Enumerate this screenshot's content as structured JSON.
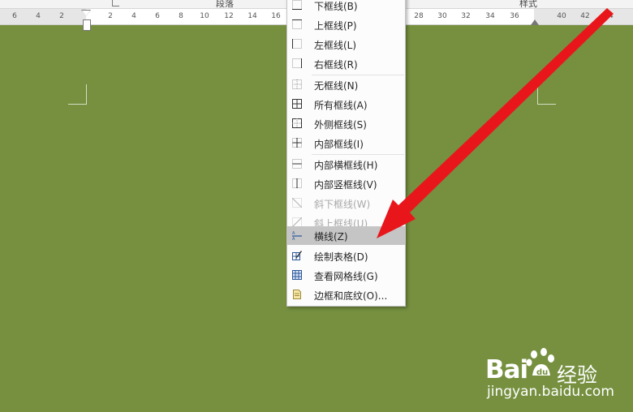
{
  "ribbon": {
    "group_paragraph": "段落",
    "group_styles": "样式"
  },
  "ruler": {
    "numbers": [
      "6",
      "4",
      "2",
      "2",
      "4",
      "6",
      "8",
      "10",
      "12",
      "14",
      "16",
      "28",
      "30",
      "32",
      "34",
      "36",
      "40",
      "42",
      "44"
    ]
  },
  "menu": {
    "items": [
      {
        "label": "下框线(B)",
        "disabled": false
      },
      {
        "label": "上框线(P)",
        "disabled": false
      },
      {
        "label": "左框线(L)",
        "disabled": false
      },
      {
        "label": "右框线(R)",
        "disabled": false
      },
      {
        "label": "无框线(N)",
        "disabled": false
      },
      {
        "label": "所有框线(A)",
        "disabled": false
      },
      {
        "label": "外侧框线(S)",
        "disabled": false
      },
      {
        "label": "内部框线(I)",
        "disabled": false
      },
      {
        "label": "内部横框线(H)",
        "disabled": false
      },
      {
        "label": "内部竖框线(V)",
        "disabled": false
      },
      {
        "label": "斜下框线(W)",
        "disabled": true
      },
      {
        "label": "斜上框线(U)",
        "disabled": true
      },
      {
        "label": "横线(Z)",
        "disabled": false,
        "highlighted": true
      },
      {
        "label": "绘制表格(D)",
        "disabled": false
      },
      {
        "label": "查看网格线(G)",
        "disabled": false
      },
      {
        "label": "边框和底纹(O)...",
        "disabled": false
      }
    ]
  },
  "watermark": {
    "brand": "Bai",
    "brand2": "经验",
    "url": "jingyan.baidu.com"
  },
  "colors": {
    "background": "#769040",
    "arrow": "#e8161b",
    "highlight": "#c5c5c5"
  }
}
